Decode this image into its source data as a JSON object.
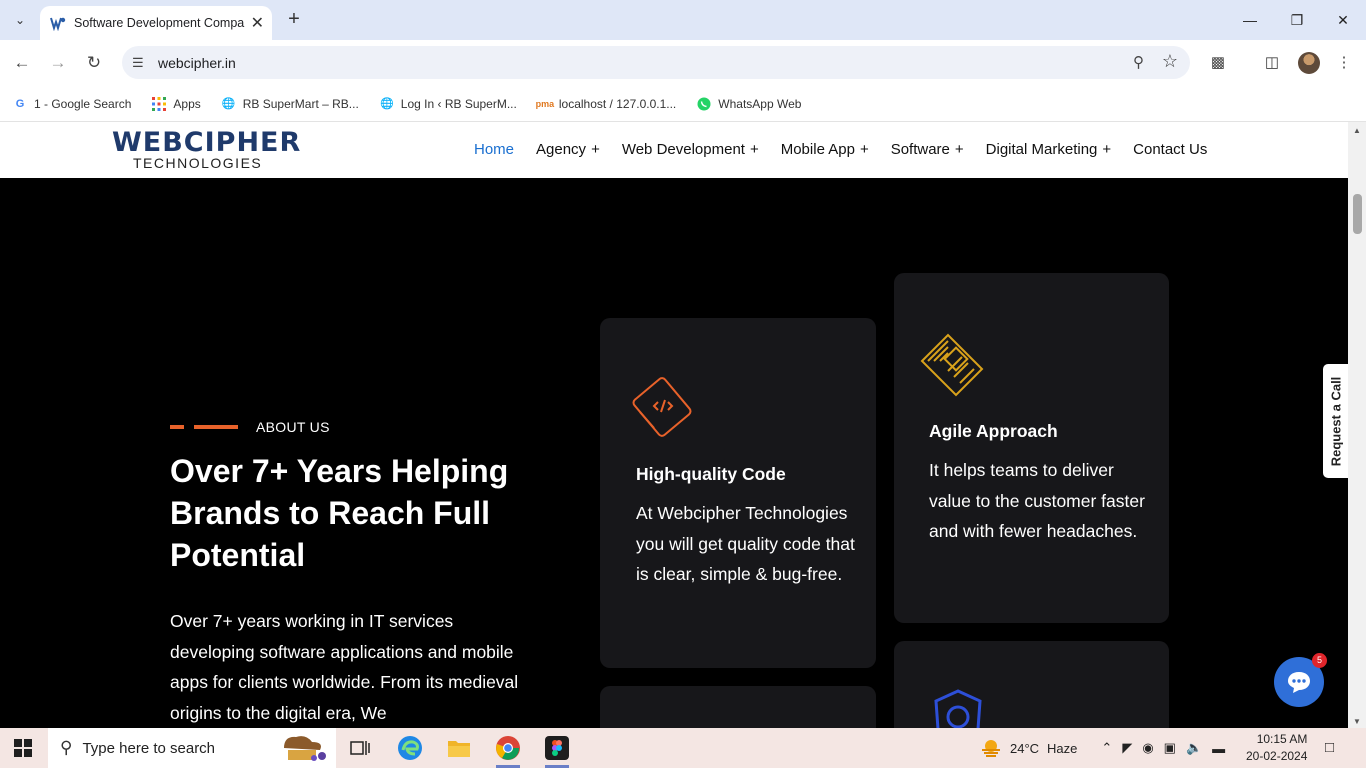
{
  "browser": {
    "tab_title": "Software Development Compar",
    "url": "webcipher.in",
    "bookmarks": [
      {
        "label": "1 - Google Search"
      },
      {
        "label": "Apps"
      },
      {
        "label": "RB SuperMart – RB..."
      },
      {
        "label": "Log In ‹ RB SuperM..."
      },
      {
        "label": "localhost / 127.0.0.1..."
      },
      {
        "label": "WhatsApp Web"
      }
    ]
  },
  "site": {
    "logo_main": "WEBCIPHER",
    "logo_sub": "TECHNOLOGIES",
    "nav": [
      {
        "label": "Home",
        "plus": ""
      },
      {
        "label": "Agency",
        "plus": "+"
      },
      {
        "label": "Web Development",
        "plus": "+"
      },
      {
        "label": "Mobile App",
        "plus": "+"
      },
      {
        "label": "Software",
        "plus": "+"
      },
      {
        "label": "Digital Marketing",
        "plus": "+"
      },
      {
        "label": "Contact Us",
        "plus": ""
      }
    ]
  },
  "hero": {
    "section_label": "ABOUT US",
    "title": "Over 7+ Years Helping Brands to Reach Full Potential",
    "paragraph": "Over 7+ years working in IT services developing software applications and mobile apps for clients worldwide. From its medieval origins to the digital era, We"
  },
  "cards": [
    {
      "title": "High-quality Code",
      "desc": "At Webcipher Technologies you will get quality code that is clear, simple & bug-free."
    },
    {
      "title": "Agile Approach",
      "desc": "It helps teams to deliver value to the customer faster and with fewer headaches."
    }
  ],
  "widgets": {
    "request_call": "Request a Call",
    "chat_badge": "5"
  },
  "taskbar": {
    "search_placeholder": "Type here to search",
    "temperature": "24°C",
    "weather": "Haze",
    "time": "10:15 AM",
    "date": "20-02-2024"
  },
  "colors": {
    "accent_orange": "#e8622a",
    "nav_active": "#1a6fd0",
    "card_bg": "#17171a",
    "chat_blue": "#2f6fd8"
  }
}
